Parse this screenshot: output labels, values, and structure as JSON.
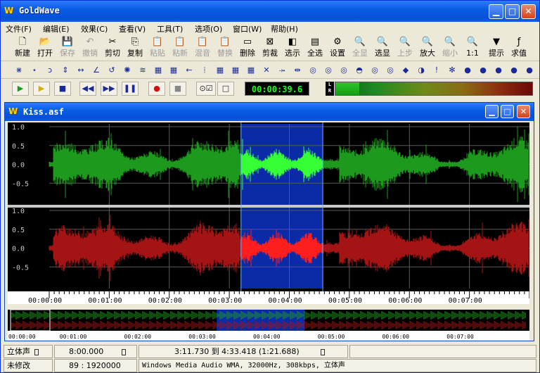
{
  "app": {
    "title": "GoldWave",
    "logo": "W"
  },
  "window_controls": [
    "minimize-icon",
    "maximize-icon",
    "close-icon"
  ],
  "menu": [
    "文件(F)",
    "编辑(E)",
    "效果(C)",
    "查看(V)",
    "工具(T)",
    "选项(O)",
    "窗口(W)",
    "帮助(H)"
  ],
  "toolbar1": [
    {
      "label": "新建",
      "icon": "new-file-icon",
      "enabled": true
    },
    {
      "label": "打开",
      "icon": "open-folder-icon",
      "enabled": true
    },
    {
      "label": "保存",
      "icon": "save-icon",
      "enabled": false
    },
    {
      "label": "撤销",
      "icon": "undo-icon",
      "enabled": false
    },
    {
      "label": "剪切",
      "icon": "cut-icon",
      "enabled": true
    },
    {
      "label": "复制",
      "icon": "copy-icon",
      "enabled": true
    },
    {
      "label": "粘贴",
      "icon": "paste-icon",
      "enabled": false
    },
    {
      "label": "粘新",
      "icon": "paste-new-icon",
      "enabled": false
    },
    {
      "label": "混音",
      "icon": "mix-icon",
      "enabled": false
    },
    {
      "label": "替换",
      "icon": "replace-icon",
      "enabled": false
    },
    {
      "label": "删除",
      "icon": "delete-icon",
      "enabled": true
    },
    {
      "label": "剪裁",
      "icon": "trim-icon",
      "enabled": true
    },
    {
      "label": "选示",
      "icon": "show-selection-icon",
      "enabled": true
    },
    {
      "label": "全选",
      "icon": "select-all-icon",
      "enabled": true
    },
    {
      "label": "设置",
      "icon": "settings-icon",
      "enabled": true
    },
    {
      "label": "全显",
      "icon": "zoom-all-icon",
      "enabled": false
    },
    {
      "label": "选显",
      "icon": "zoom-selection-icon",
      "enabled": true
    },
    {
      "label": "上步",
      "icon": "previous-zoom-icon",
      "enabled": false
    },
    {
      "label": "放大",
      "icon": "zoom-in-icon",
      "enabled": true
    },
    {
      "label": "缩小",
      "icon": "zoom-out-icon",
      "enabled": false
    },
    {
      "label": "1:1",
      "icon": "zoom-1to1-icon",
      "enabled": true
    },
    {
      "label": "提示",
      "icon": "cue-icon",
      "enabled": true
    },
    {
      "label": "求值",
      "icon": "evaluate-icon",
      "enabled": true
    }
  ],
  "toolbar2_icons": [
    "effect-1-icon",
    "effect-2-icon",
    "effect-3-icon",
    "effect-4-icon",
    "effect-5-icon",
    "effect-6-icon",
    "effect-7-icon",
    "effect-8-icon",
    "effect-9-icon",
    "effect-10-icon",
    "effect-11-icon",
    "effect-12-icon",
    "effect-13-icon",
    "effect-14-icon",
    "effect-15-icon",
    "effect-16-icon",
    "effect-17-icon",
    "effect-18-icon",
    "effect-19-icon",
    "effect-20-icon",
    "effect-21-icon",
    "effect-22-icon",
    "effect-23-icon",
    "effect-24-icon",
    "effect-25-icon",
    "effect-26-icon",
    "effect-27-icon",
    "effect-28-icon",
    "effect-29-icon",
    "effect-30-icon",
    "effect-31-icon",
    "effect-32-icon",
    "effect-33-icon",
    "effect-34-icon"
  ],
  "transport": {
    "icons": [
      "play-icon",
      "play-selection-icon",
      "stop-icon",
      "rewind-icon",
      "fast-forward-icon",
      "pause-icon",
      "record-icon",
      "record-stop-icon",
      "monitor-checkbox-icon",
      "window-icon"
    ],
    "time": "00:00:39.6",
    "meter_labels": [
      "L",
      "R"
    ],
    "meter_level": 0.12
  },
  "document": {
    "title": "Kiss.asf",
    "logo": "W"
  },
  "waveform": {
    "duration_sec": 480,
    "selection_sec": [
      191.73,
      273.418
    ],
    "amplitude_labels": [
      "1.0",
      "0.5",
      "0.0",
      "-0.5"
    ],
    "time_labels": [
      "00:00:00",
      "00:01:00",
      "00:02:00",
      "00:03:00",
      "00:04:00",
      "00:05:00",
      "00:06:00",
      "00:07:00"
    ],
    "colors": {
      "left": "#1d9a1d",
      "left_selected": "#36ff36",
      "right": "#a51414",
      "right_selected": "#ff1e1e",
      "selection_bg": "#0a2aa8",
      "grid": "#5a5a5a",
      "background": "#000000"
    }
  },
  "status": {
    "channels": "立体声",
    "length": "8:00.000",
    "selection": "3:11.730 到 4:33.418 (1:21.688)",
    "modified": "未修改",
    "position": "89 : 1920000",
    "format": "Windows Media Audio WMA, 32000Hz, 308kbps, 立体声"
  }
}
